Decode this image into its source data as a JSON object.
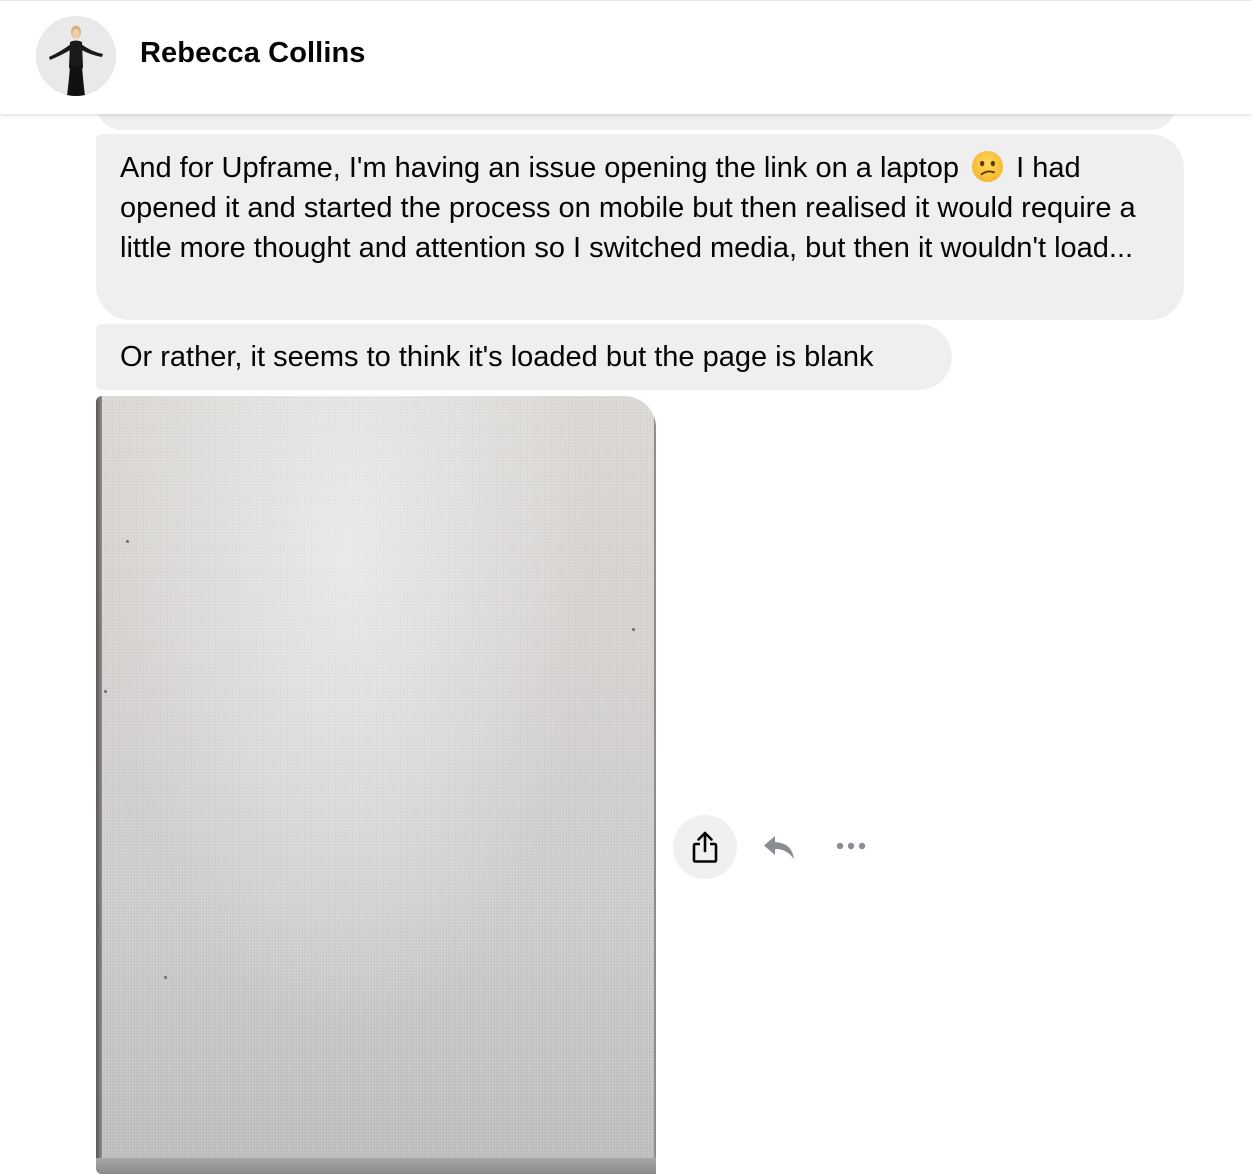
{
  "header": {
    "contact_name": "Rebecca Collins",
    "avatar_icon": "profile-photo"
  },
  "messages": [
    {
      "type": "text",
      "text_before_emoji": "And for Upframe, I'm having an issue opening the link on a laptop",
      "emoji": "confused-face-emoji",
      "text_after_emoji": "I had opened it and started the process on mobile but then realised it would require a little more thought and attention so I switched media, but then it wouldn't load..."
    },
    {
      "type": "text",
      "text": "Or rather, it seems to think it's loaded but the page is blank"
    },
    {
      "type": "image",
      "content": "photo-of-blank-laptop-screen"
    }
  ],
  "message_actions": [
    {
      "icon": "share-icon"
    },
    {
      "icon": "reply-icon"
    },
    {
      "icon": "more-options-icon"
    }
  ],
  "colors": {
    "bubble_bg": "#efefef",
    "text": "#050505",
    "icon_gray": "#8a8d91",
    "share_bg": "#f0f0f0"
  }
}
